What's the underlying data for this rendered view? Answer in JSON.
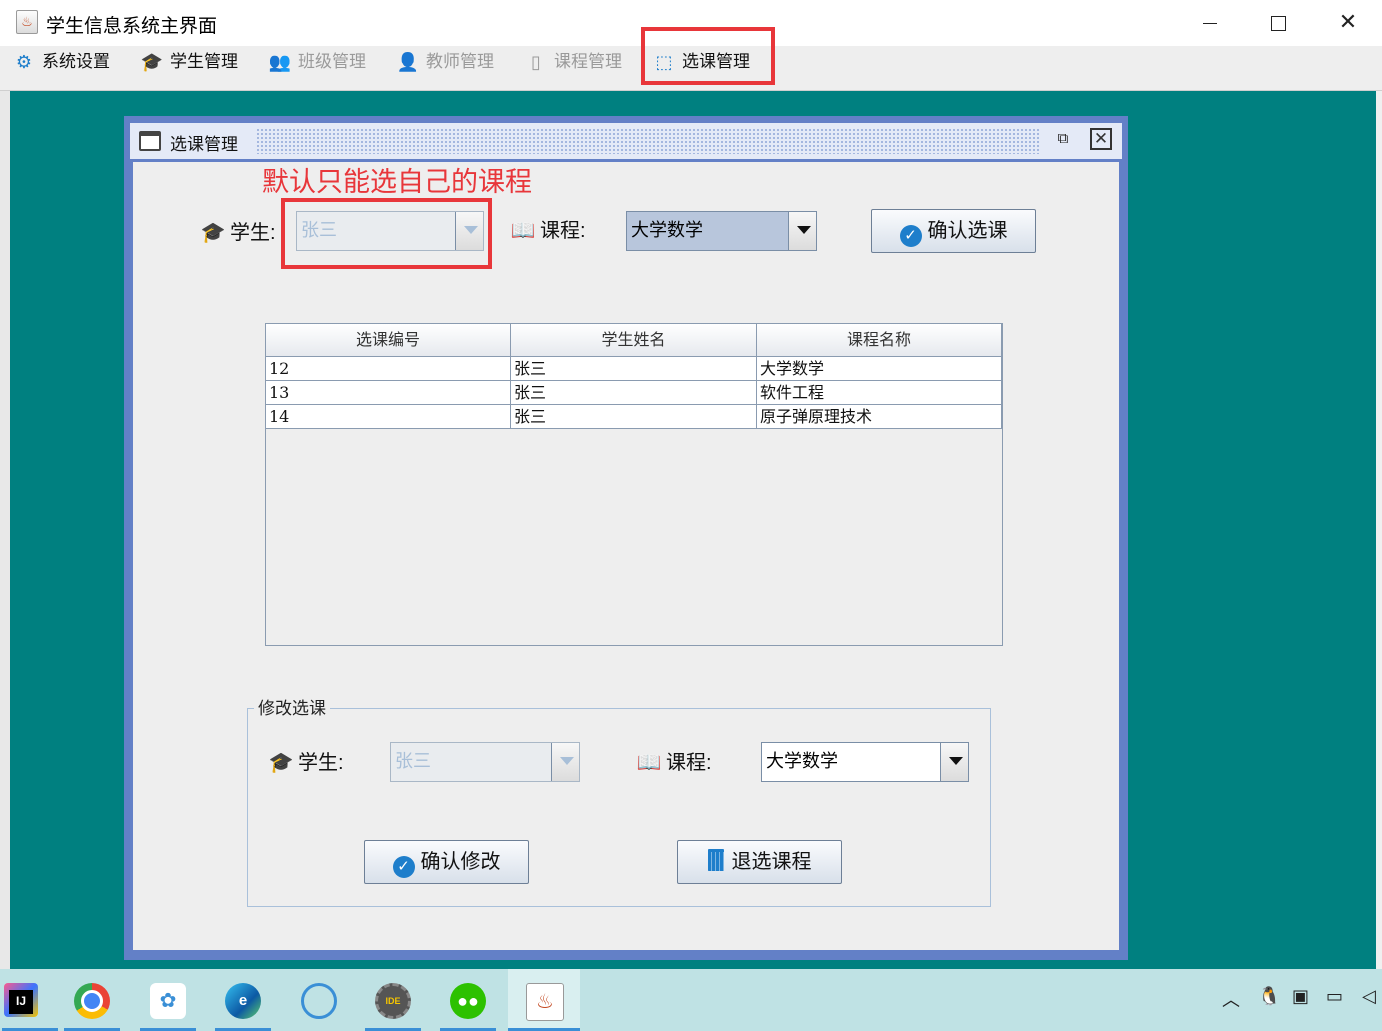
{
  "window": {
    "title": "学生信息系统主界面"
  },
  "menubar": {
    "items": [
      {
        "label": "系统设置",
        "icon": "gear-icon",
        "enabled": true
      },
      {
        "label": "学生管理",
        "icon": "graduate-icon",
        "enabled": true
      },
      {
        "label": "班级管理",
        "icon": "users-icon",
        "enabled": false
      },
      {
        "label": "教师管理",
        "icon": "teacher-icon",
        "enabled": false
      },
      {
        "label": "课程管理",
        "icon": "book-icon",
        "enabled": false
      },
      {
        "label": "选课管理",
        "icon": "cursor-icon",
        "enabled": true
      }
    ]
  },
  "frame": {
    "title": "选课管理"
  },
  "annotation": "默认只能选自己的课程",
  "select_form": {
    "student_label": "学生:",
    "student_value": "张三",
    "course_label": "课程:",
    "course_value": "大学数学",
    "confirm_label": "确认选课"
  },
  "table": {
    "columns": [
      "选课编号",
      "学生姓名",
      "课程名称"
    ],
    "rows": [
      [
        "12",
        "张三",
        "大学数学"
      ],
      [
        "13",
        "张三",
        "软件工程"
      ],
      [
        "14",
        "张三",
        "原子弹原理技术"
      ]
    ]
  },
  "modify_form": {
    "title": "修改选课",
    "student_label": "学生:",
    "student_value": "张三",
    "course_label": "课程:",
    "course_value": "大学数学",
    "modify_label": "确认修改",
    "drop_label": "退选课程"
  },
  "colors": {
    "desktop": "#008080",
    "frame_border": "#6380c7",
    "highlight": "#e8363a",
    "accent": "#1e7ecb"
  }
}
